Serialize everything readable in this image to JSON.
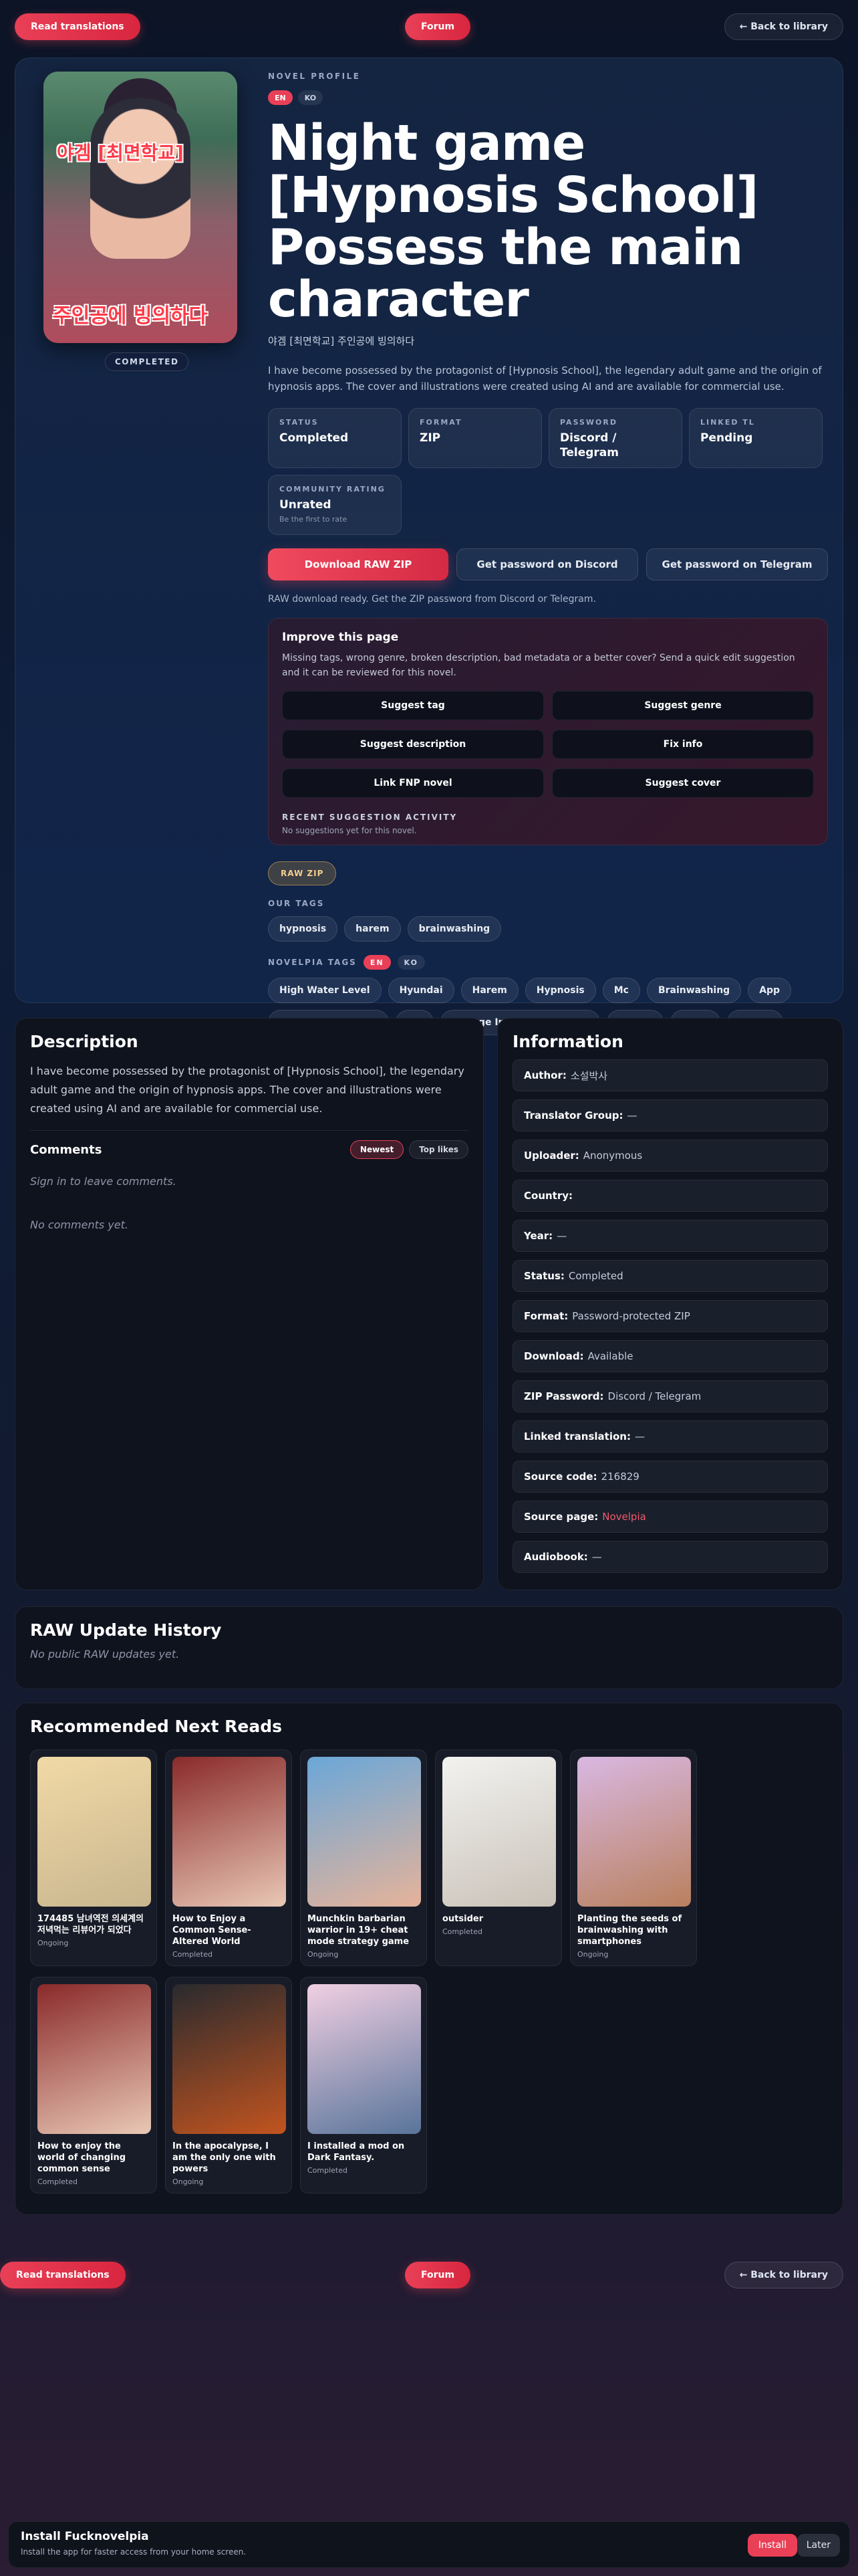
{
  "nav": {
    "read_translations": "Read translations",
    "forum": "Forum",
    "back": "← Back to library"
  },
  "cover": {
    "top_text": "야겜 [최면학교]",
    "bottom_text": "주인공에 빙의하다",
    "status": "COMPLETED"
  },
  "profile": {
    "eyebrow": "NOVEL PROFILE",
    "langs": [
      "EN",
      "KO"
    ],
    "title": "Night game [Hypnosis School] Possess the main character",
    "subtitle": "야겜 [최면학교] 주인공에 빙의하다",
    "description": "I have become possessed by the protagonist of [Hypnosis School], the legendary adult game and the origin of hypnosis apps. The cover and illustrations were created using AI and are available for commercial use."
  },
  "stats": [
    {
      "key": "STATUS",
      "value": "Completed"
    },
    {
      "key": "FORMAT",
      "value": "ZIP"
    },
    {
      "key": "PASSWORD",
      "value": "Discord / Telegram"
    },
    {
      "key": "LINKED TL",
      "value": "Pending"
    },
    {
      "key": "COMMUNITY RATING",
      "value": "Unrated",
      "sub": "Be the first to rate"
    }
  ],
  "actions": {
    "download": "Download RAW ZIP",
    "discord": "Get password on Discord",
    "telegram": "Get password on Telegram"
  },
  "download_note": "RAW download ready. Get the ZIP password from Discord or Telegram.",
  "improve": {
    "title": "Improve this page",
    "text": "Missing tags, wrong genre, broken description, bad metadata or a better cover? Send a quick edit suggestion and it can be reviewed for this novel.",
    "buttons": [
      "Suggest tag",
      "Suggest genre",
      "Suggest description",
      "Fix info",
      "Link FNP novel",
      "Suggest cover"
    ],
    "recent_label": "RECENT SUGGESTION ACTIVITY",
    "recent_value": "No suggestions yet for this novel."
  },
  "raw_badge": "RAW ZIP",
  "our_tags_label": "OUR TAGS",
  "our_tags": [
    "hypnosis",
    "harem",
    "brainwashing"
  ],
  "novelpia_tags_label": "NOVELPIA TAGS",
  "novelpia_tags": [
    "High Water Level",
    "Hyundai",
    "Harem",
    "Hypnosis",
    "Mc",
    "Brainwashing",
    "App",
    "Mind Manipulation",
    "Ntl",
    "Change In Common Sense",
    "school",
    "adult",
    "harem"
  ],
  "description_panel": {
    "title": "Description",
    "text": "I have become possessed by the protagonist of [Hypnosis School], the legendary adult game and the origin of hypnosis apps. The cover and illustrations were created using AI and are available for commercial use.",
    "comments_title": "Comments",
    "sort_newest": "Newest",
    "sort_top": "Top likes",
    "sign_in": "Sign in to leave comments.",
    "empty": "No comments yet."
  },
  "information": {
    "title": "Information",
    "rows": [
      {
        "label": "Author:",
        "value": "소설박사"
      },
      {
        "label": "Translator Group:",
        "value": "—"
      },
      {
        "label": "Uploader:",
        "value": "Anonymous"
      },
      {
        "label": "Country:",
        "value": ""
      },
      {
        "label": "Year:",
        "value": "—"
      },
      {
        "label": "Status:",
        "value": "Completed"
      },
      {
        "label": "Format:",
        "value": "Password-protected ZIP"
      },
      {
        "label": "Download:",
        "value": "Available"
      },
      {
        "label": "ZIP Password:",
        "value": "Discord / Telegram"
      },
      {
        "label": "Linked translation:",
        "value": "—"
      },
      {
        "label": "Source code:",
        "value": "216829"
      },
      {
        "label": "Source page:",
        "value": "Novelpia"
      },
      {
        "label": "Audiobook:",
        "value": "—"
      }
    ]
  },
  "history": {
    "title": "RAW Update History",
    "empty": "No public RAW updates yet."
  },
  "recommended": {
    "title": "Recommended Next Reads",
    "cards": [
      {
        "name": "174485 남녀역전 의세계의 저녁먹는 리뷰어가 되었다",
        "status": "Ongoing",
        "c1": "#f1d9a6",
        "c2": "#c9b68f"
      },
      {
        "name": "How to Enjoy a Common Sense-Altered World",
        "status": "Completed",
        "c1": "#8a2a2a",
        "c2": "#e9c8b6"
      },
      {
        "name": "Munchkin barbarian warrior in 19+ cheat mode strategy game",
        "status": "Ongoing",
        "c1": "#6aa7d8",
        "c2": "#e6b39a"
      },
      {
        "name": "outsider",
        "status": "Completed",
        "c1": "#f2f2f0",
        "c2": "#c9c2b8"
      },
      {
        "name": "Planting the seeds of brainwashing with smartphones",
        "status": "Ongoing",
        "c1": "#d9b8e2",
        "c2": "#b9805e"
      },
      {
        "name": "How to enjoy the world of changing common sense",
        "status": "Completed",
        "c1": "#8a2a2a",
        "c2": "#e9c8b6"
      },
      {
        "name": "In the apocalypse, I am the only one with powers",
        "status": "Ongoing",
        "c1": "#2a2a2e",
        "c2": "#c2541f"
      },
      {
        "name": "I installed a mod on Dark Fantasy.",
        "status": "Completed",
        "c1": "#f1cfe2",
        "c2": "#58749a"
      }
    ]
  },
  "install": {
    "title": "Install Fucknovelpia",
    "subtitle": "Install the app for faster access from your home screen.",
    "install": "Install",
    "later": "Later"
  }
}
